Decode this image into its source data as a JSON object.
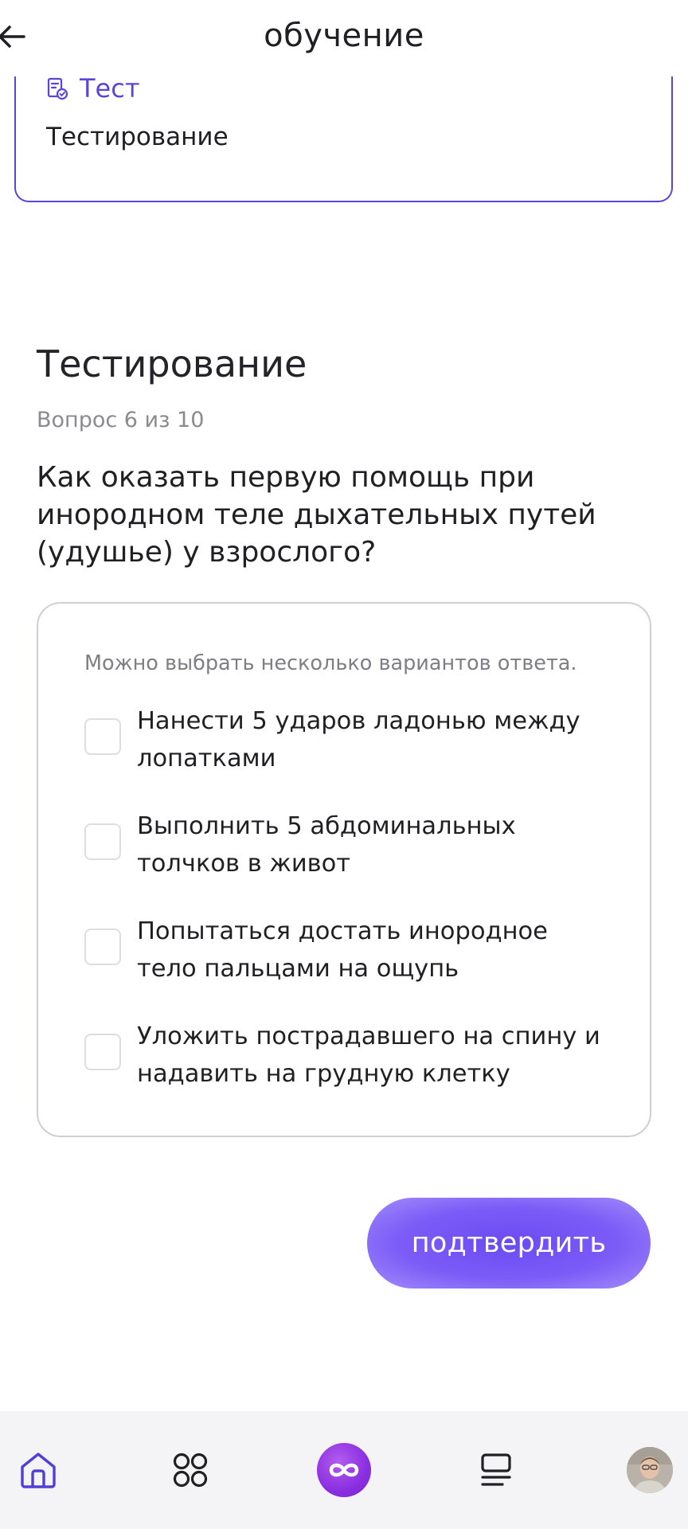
{
  "header": {
    "title": "обучение",
    "back_icon": "arrow-left-icon"
  },
  "course_card": {
    "type_label": "Тест",
    "type_icon": "test-document-icon",
    "name": "Тестирование"
  },
  "test": {
    "title": "Тестирование",
    "counter": "Вопрос 6 из 10",
    "question": "Как оказать первую помощь при инородном теле дыхательных путей (удушье) у взрослого?",
    "hint": "Можно выбрать несколько вариантов ответа.",
    "options": [
      {
        "label": "Нанести 5 ударов ладонью между лопатками",
        "checked": false
      },
      {
        "label": "Выполнить 5 абдоминальных толчков в живот",
        "checked": false
      },
      {
        "label": "Попытаться достать инородное тело пальцами на ощупь",
        "checked": false
      },
      {
        "label": "Уложить пострадавшего на спину и надавить на грудную клетку",
        "checked": false
      }
    ],
    "confirm_label": "подтвердить"
  },
  "bottom_nav": {
    "items": [
      {
        "icon": "home-icon",
        "active": true
      },
      {
        "icon": "apps-grid-icon",
        "active": false
      },
      {
        "icon": "infinity-logo-icon",
        "active": false
      },
      {
        "icon": "list-icon",
        "active": false
      },
      {
        "icon": "user-avatar",
        "active": false
      }
    ]
  },
  "colors": {
    "accent": "#5b45d8",
    "button": "#7c5cf7",
    "nav_active": "#4f3fd6",
    "text": "#1f1f24",
    "muted": "#8a8a90"
  }
}
